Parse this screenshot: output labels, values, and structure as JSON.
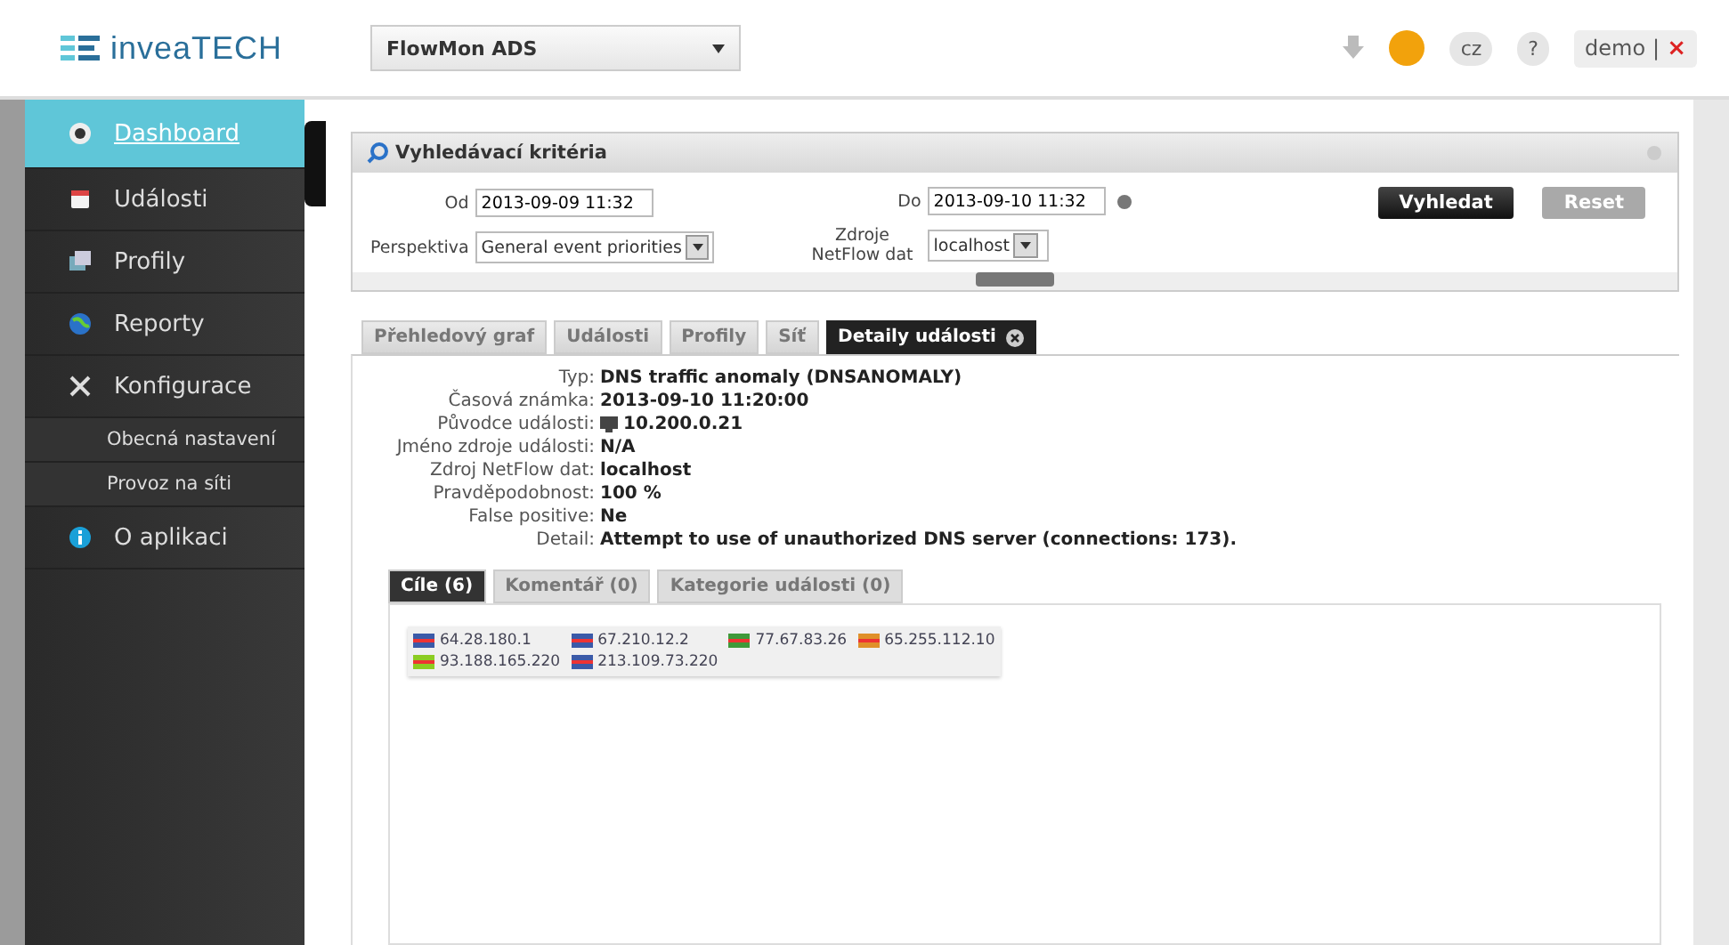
{
  "header": {
    "logo": "inveaTECH",
    "product": "FlowMon ADS",
    "language": "cz",
    "help": "?",
    "user": "demo",
    "separator": "|",
    "logout": "×"
  },
  "sidebar": {
    "items": [
      {
        "label": "Dashboard",
        "selected": true
      },
      {
        "label": "Události",
        "selected": false
      },
      {
        "label": "Profily",
        "selected": false
      },
      {
        "label": "Reporty",
        "selected": false
      },
      {
        "label": "Konfigurace",
        "selected": false,
        "children": [
          {
            "label": "Obecná nastavení",
            "selected": false
          },
          {
            "label": "Provoz na síti",
            "selected": false
          }
        ]
      },
      {
        "label": "O aplikaci",
        "selected": false
      }
    ]
  },
  "search": {
    "title": "Vyhledávací kritéria",
    "from": {
      "label": "Od",
      "value": "2013-09-09 11:32"
    },
    "to": {
      "label": "Do",
      "value": "2013-09-10 11:32"
    },
    "perspective": {
      "label": "Perspektiva",
      "value": "General event priorities"
    },
    "source": {
      "label": "Zdroje NetFlow dat",
      "value": "localhost"
    },
    "buttons": [
      {
        "label": "Vyhledat",
        "kind": "primary"
      },
      {
        "label": "Reset",
        "kind": "secondary"
      }
    ]
  },
  "tabs": [
    {
      "label": "Přehledový graf",
      "selected": false,
      "closable": false
    },
    {
      "label": "Události",
      "selected": false,
      "closable": false
    },
    {
      "label": "Profily",
      "selected": false,
      "closable": false
    },
    {
      "label": "Síť",
      "selected": false,
      "closable": false
    },
    {
      "label": "Detaily události",
      "selected": true,
      "closable": true
    }
  ],
  "details": [
    {
      "label": "Typ:",
      "value": "DNS traffic anomaly (DNSANOMALY)",
      "icon": false
    },
    {
      "label": "Časová známka:",
      "value": "2013-09-10 11:20:00",
      "icon": false
    },
    {
      "label": "Původce události:",
      "value": "10.200.0.21",
      "icon": true
    },
    {
      "label": "Jméno zdroje události:",
      "value": "N/A",
      "icon": false
    },
    {
      "label": "Zdroj NetFlow dat:",
      "value": "localhost",
      "icon": false
    },
    {
      "label": "Pravděpodobnost:",
      "value": "100 %",
      "icon": false
    },
    {
      "label": "False positive:",
      "value": "Ne",
      "icon": false
    },
    {
      "label": "Detail:",
      "value": "Attempt to use of unauthorized DNS server (connections: 173).",
      "icon": false
    }
  ],
  "subtabs": [
    {
      "label": "Cíle (6)",
      "selected": true
    },
    {
      "label": "Komentář (0)",
      "selected": false
    },
    {
      "label": "Kategorie události (0)",
      "selected": false
    }
  ],
  "targets": [
    {
      "ip": "64.28.180.1",
      "color": "#3b5aa8"
    },
    {
      "ip": "67.210.12.2",
      "color": "#3b5aa8"
    },
    {
      "ip": "77.67.83.26",
      "color": "#3f9a3a"
    },
    {
      "ip": "65.255.112.10",
      "color": "#e0902a"
    },
    {
      "ip": "93.188.165.220",
      "color": "#8ccc22"
    },
    {
      "ip": "213.109.73.220",
      "color": "#3b5aa8"
    }
  ]
}
